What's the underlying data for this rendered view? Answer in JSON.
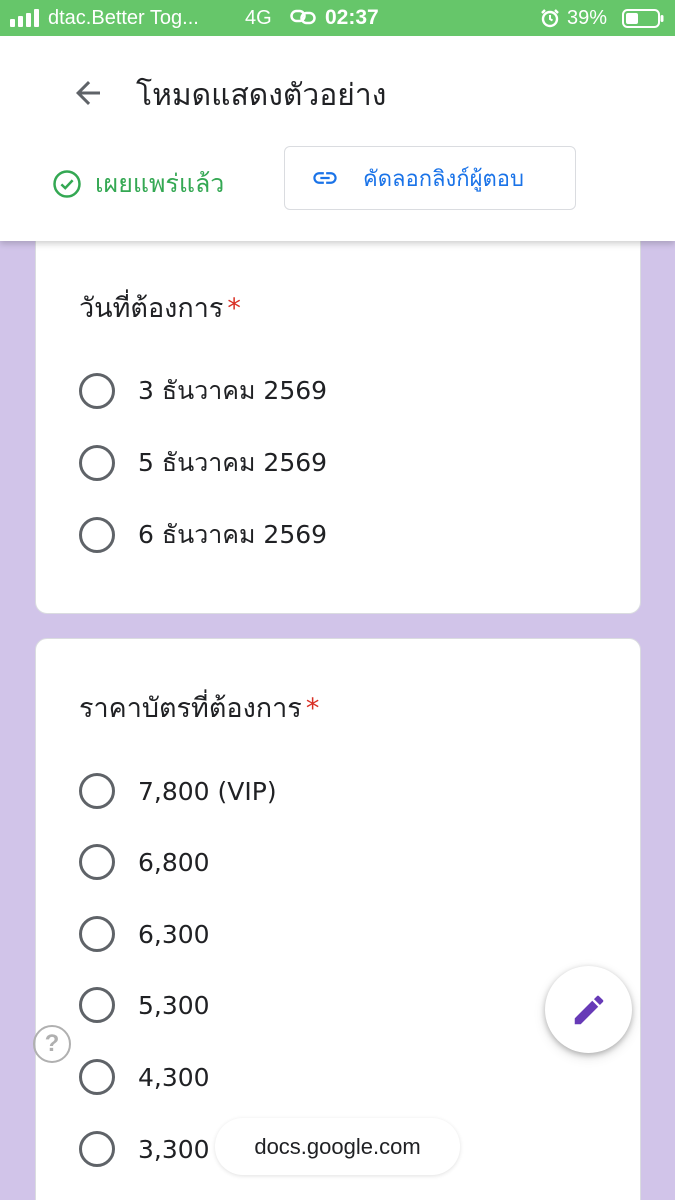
{
  "status_bar": {
    "carrier": "dtac.Better Tog...",
    "network": "4G",
    "time": "02:37",
    "battery": "39%"
  },
  "header": {
    "title": "โหมดแสดงตัวอย่าง",
    "published_label": "เผยแพร่แล้ว",
    "copy_link_label": "คัดลอกลิงก์ผู้ตอบ"
  },
  "questions": [
    {
      "title": "วันที่ต้องการ",
      "required_mark": "*",
      "options": [
        "3 ธันวาคม 2569",
        "5 ธันวาคม 2569",
        "6 ธันวาคม 2569"
      ]
    },
    {
      "title": "ราคาบัตรที่ต้องการ",
      "required_mark": "*",
      "options": [
        "7,800 (VIP)",
        "6,800",
        "6,300",
        "5,300",
        "4,300",
        "3,300"
      ]
    }
  ],
  "help_icon_text": "?",
  "url_bar": "docs.google.com",
  "icons": {
    "back": "arrow-left-icon",
    "published": "check-circle-icon",
    "copy_link": "link-icon",
    "edit": "pencil-icon",
    "help": "help-circle-icon"
  },
  "colors": {
    "status_bar": "#66c66a",
    "page_background": "#d1c4e9",
    "published_green": "#34a853",
    "link_blue": "#1a73e8",
    "required_red": "#d93025",
    "edit_purple": "#673ab7"
  }
}
